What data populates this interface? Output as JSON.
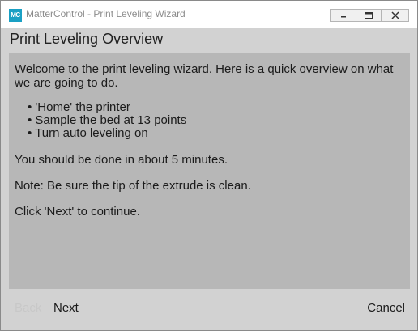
{
  "window": {
    "app_icon_text": "MC",
    "title": "MatterControl - Print Leveling Wizard",
    "controls": {
      "minimize_icon": "minimize-icon",
      "maximize_icon": "maximize-icon",
      "close_icon": "close-icon"
    }
  },
  "header": {
    "title": "Print Leveling Overview"
  },
  "content": {
    "intro": "Welcome to the print leveling wizard. Here is a quick overview on what we are going to do.",
    "steps": [
      "'Home' the printer",
      "Sample the bed at 13 points",
      "Turn auto leveling on"
    ],
    "duration": "You should be done in about 5 minutes.",
    "note": "Note: Be sure the tip of the extrude is clean.",
    "instruction": "Click 'Next' to continue."
  },
  "footer": {
    "back_label": "Back",
    "next_label": "Next",
    "cancel_label": "Cancel"
  },
  "colors": {
    "accent": "#1aa0c4",
    "panel_background": "#d2d2d2",
    "content_background": "#b7b7b7",
    "disabled_text": "#c8c8c8"
  }
}
